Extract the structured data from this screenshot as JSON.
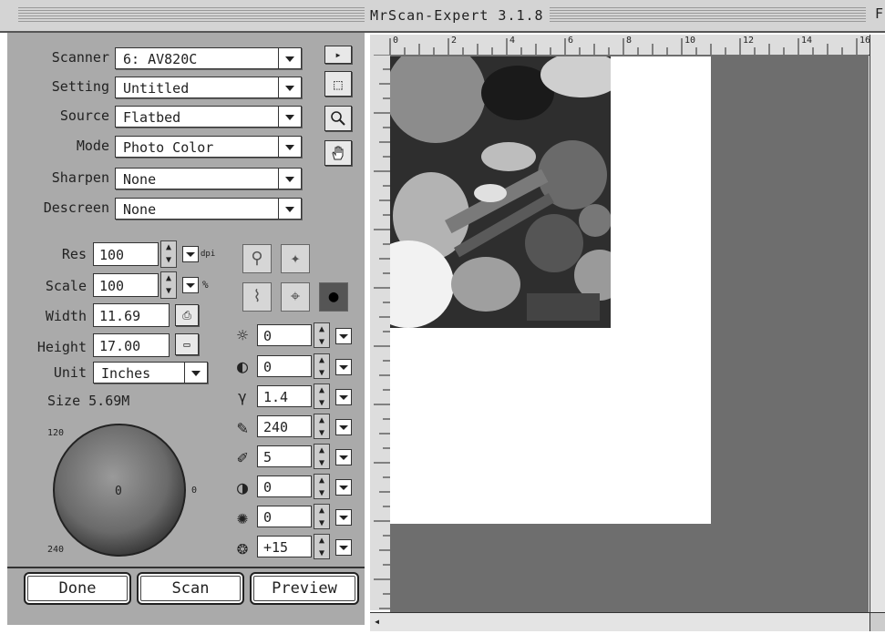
{
  "window": {
    "title": "MrScan-Expert 3.1.8",
    "title_right": "F"
  },
  "settings": {
    "scanner": {
      "label": "Scanner",
      "value": "6: AV820C"
    },
    "setting": {
      "label": "Setting",
      "value": "Untitled"
    },
    "source": {
      "label": "Source",
      "value": "Flatbed"
    },
    "mode": {
      "label": "Mode",
      "value": "Photo Color"
    },
    "sharpen": {
      "label": "Sharpen",
      "value": "None"
    },
    "descreen": {
      "label": "Descreen",
      "value": "None"
    }
  },
  "side_tools": {
    "arrow": "▸",
    "select": "⬚",
    "zoom": "🔍",
    "hand": "✋"
  },
  "dims": {
    "res": {
      "label": "Res",
      "value": "100",
      "unit": "dpi"
    },
    "scale": {
      "label": "Scale",
      "value": "100",
      "unit": "%"
    },
    "width": {
      "label": "Width",
      "value": "11.69"
    },
    "height": {
      "label": "Height",
      "value": "17.00"
    },
    "unit": {
      "label": "Unit",
      "value": "Inches"
    },
    "size": "Size 5.69M"
  },
  "dial": {
    "top": "120",
    "center": "0",
    "right": "0",
    "bottom": "240"
  },
  "adjustments": [
    {
      "name": "brightness",
      "value": "0"
    },
    {
      "name": "contrast",
      "value": "0"
    },
    {
      "name": "gamma",
      "value": "1.4"
    },
    {
      "name": "highlight",
      "value": "240"
    },
    {
      "name": "shadow",
      "value": "5"
    },
    {
      "name": "midtone",
      "value": "0"
    },
    {
      "name": "hue",
      "value": "0"
    },
    {
      "name": "saturation",
      "value": "+15"
    }
  ],
  "buttons": {
    "done": "Done",
    "scan": "Scan",
    "preview": "Preview"
  },
  "ruler": {
    "top_marks": [
      "0",
      "2",
      "4",
      "6",
      "8",
      "10",
      "12",
      "14",
      "16"
    ]
  },
  "colors": {
    "panel": "#aaaaaa",
    "canvas": "#6e6e6e",
    "paper": "#ffffff"
  }
}
